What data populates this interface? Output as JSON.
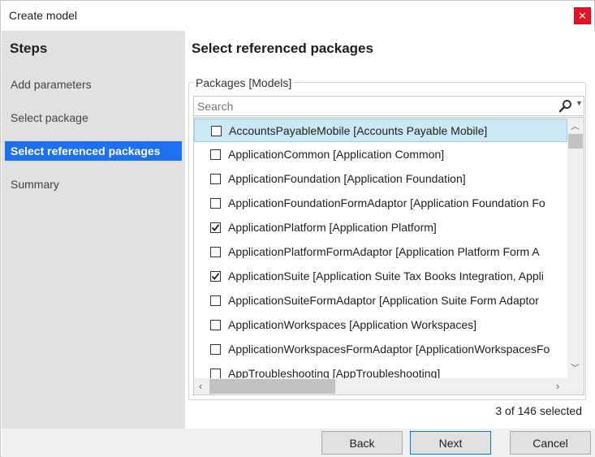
{
  "window": {
    "title": "Create model"
  },
  "sidebar": {
    "heading": "Steps",
    "items": [
      {
        "label": "Add parameters",
        "active": false
      },
      {
        "label": "Select package",
        "active": false
      },
      {
        "label": "Select referenced packages",
        "active": true
      },
      {
        "label": "Summary",
        "active": false
      }
    ]
  },
  "main": {
    "heading": "Select referenced packages",
    "group_label": "Packages [Models]",
    "search": {
      "placeholder": "Search",
      "value": ""
    },
    "packages": [
      {
        "label": "AccountsPayableMobile [Accounts Payable Mobile]",
        "checked": false,
        "selected": true
      },
      {
        "label": "ApplicationCommon [Application Common]",
        "checked": false,
        "selected": false
      },
      {
        "label": "ApplicationFoundation [Application Foundation]",
        "checked": false,
        "selected": false
      },
      {
        "label": "ApplicationFoundationFormAdaptor [Application Foundation Fo",
        "checked": false,
        "selected": false
      },
      {
        "label": "ApplicationPlatform [Application Platform]",
        "checked": true,
        "selected": false
      },
      {
        "label": "ApplicationPlatformFormAdaptor [Application Platform Form A",
        "checked": false,
        "selected": false
      },
      {
        "label": "ApplicationSuite [Application Suite Tax Books Integration, Appli",
        "checked": true,
        "selected": false
      },
      {
        "label": "ApplicationSuiteFormAdaptor [Application Suite Form Adaptor",
        "checked": false,
        "selected": false
      },
      {
        "label": "ApplicationWorkspaces [Application Workspaces]",
        "checked": false,
        "selected": false
      },
      {
        "label": "ApplicationWorkspacesFormAdaptor [ApplicationWorkspacesFo",
        "checked": false,
        "selected": false
      },
      {
        "label": "AppTroubleshooting [AppTroubleshooting]",
        "checked": false,
        "selected": false
      }
    ],
    "selection_count": "3 of 146 selected"
  },
  "footer": {
    "back_label": "Back",
    "next_label": "Next",
    "cancel_label": "Cancel"
  },
  "colors": {
    "accent": "#1e70f0",
    "selected_row": "#cce8f4",
    "close_button": "#e81123"
  },
  "icons": {
    "close": "close-icon",
    "search": "search-icon",
    "dropdown": "chevron-down-icon",
    "scroll_up": "chevron-up-icon",
    "scroll_down": "chevron-down-icon",
    "scroll_left": "chevron-left-icon",
    "scroll_right": "chevron-right-icon",
    "check": "checkmark-icon"
  }
}
